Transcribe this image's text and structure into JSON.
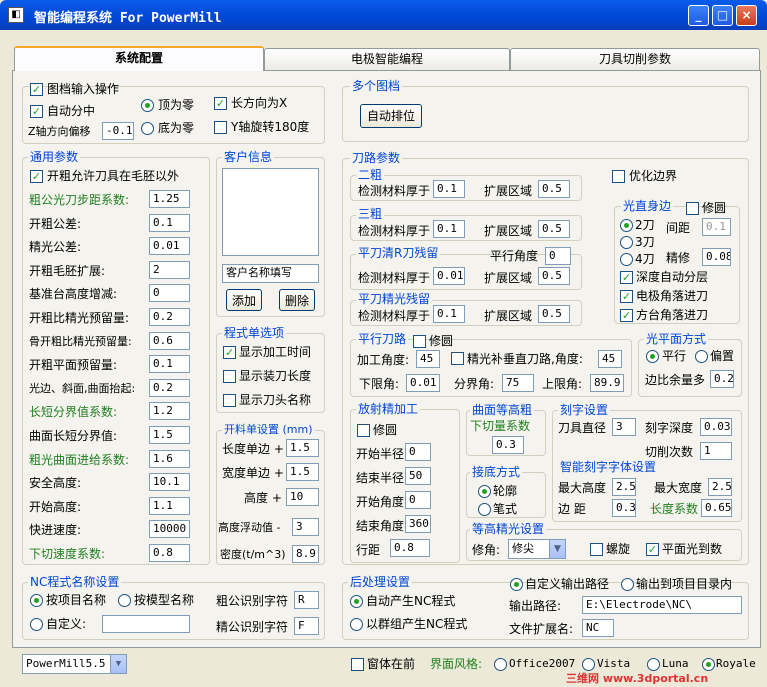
{
  "window": {
    "icon": "app-icon",
    "title": "智能编程系统 For PowerMill",
    "min": "_",
    "max": "□",
    "close": "×"
  },
  "tabs": [
    "系统配置",
    "电极智能编程",
    "刀具切削参数"
  ],
  "top": {
    "input_op": "图档输入操作",
    "auto_center": "自动分中",
    "top_zero": "顶为零",
    "bottom_zero": "底为零",
    "long_x": "长方向为X",
    "y_rot": "Y轴旋转180度",
    "z_offset_label": "Z轴方向偏移",
    "z_offset": "-0.1"
  },
  "multi": {
    "title": "多个图档",
    "auto_arrange": "自动排位"
  },
  "general": {
    "title": "通用参数",
    "allow_tool": "开粗允许刀具在毛胚以外",
    "rows": [
      {
        "label": "粗公光刀步距系数:",
        "value": "1.25",
        "green": true
      },
      {
        "label": "开粗公差:",
        "value": "0.1"
      },
      {
        "label": "精光公差:",
        "value": "0.01"
      },
      {
        "label": "开粗毛胚扩展:",
        "value": "2"
      },
      {
        "label": "基准台高度增减:",
        "value": "0"
      },
      {
        "label": "开粗比精光预留量:",
        "value": "0.2"
      },
      {
        "label": "骨开粗比精光预留量:",
        "value": "0.6"
      },
      {
        "label": "开粗平面预留量:",
        "value": "0.1"
      },
      {
        "label": "光边、斜面,曲面抬起:",
        "value": "0.2"
      },
      {
        "label": "长短分界值系数:",
        "value": "1.2",
        "green": true
      },
      {
        "label": "曲面长短分界值:",
        "value": "1.5"
      },
      {
        "label": "粗光曲面进给系数:",
        "value": "1.6",
        "green": true
      },
      {
        "label": "安全高度:",
        "value": "10.1"
      },
      {
        "label": "开始高度:",
        "value": "1.1"
      },
      {
        "label": "快进速度:",
        "value": "10000"
      },
      {
        "label": "下切速度系数:",
        "value": "0.8",
        "green": true
      }
    ]
  },
  "customer": {
    "title": "客户信息",
    "name_placeholder": "客户名称填写",
    "add": "添加",
    "delete": "删除"
  },
  "program": {
    "title": "程式单选项",
    "show_time": "显示加工时间",
    "show_length": "显示装刀长度",
    "show_toolname": "显示刀头名称"
  },
  "slot": {
    "title": "开料单设置 (mm)",
    "len_label": "长度单边 +",
    "len": "1.5",
    "wid_label": "宽度单边 +",
    "wid": "1.5",
    "hgt_label": "高度 +",
    "hgt": "10",
    "float_label": "高度浮动值 -",
    "float": "3",
    "density_label": "密度(t/m^3)",
    "density": "8.9"
  },
  "toolpath": {
    "title": "刀路参数",
    "g2": {
      "title": "二粗",
      "detect": "检测材料厚于",
      "detect_v": "0.1",
      "expand": "扩展区域",
      "expand_v": "0.5"
    },
    "g3": {
      "title": "三粗",
      "detect": "检测材料厚于",
      "detect_v": "0.1",
      "expand": "扩展区域",
      "expand_v": "0.5"
    },
    "gflat": {
      "title": "平刀清R刀残留",
      "angle": "平行角度",
      "angle_v": "0",
      "detect": "检测材料厚于",
      "detect_v": "0.01",
      "expand": "扩展区域",
      "expand_v": "0.5"
    },
    "gfin": {
      "title": "平刀精光残留",
      "detect": "检测材料厚于",
      "detect_v": "0.1",
      "expand": "扩展区域",
      "expand_v": "0.5"
    },
    "optimize": "优化边界",
    "edge": {
      "title": "光直身边",
      "trim": "修圆",
      "r2": "2刀",
      "r3": "3刀",
      "r4": "4刀",
      "gap": "间距",
      "gap_v": "0.1",
      "fine": "精修",
      "fine_v": "0.08",
      "depth_auto": "深度自动分层",
      "elec_angle": "电极角落进刀",
      "square_angle": "方台角落进刀"
    },
    "parallel": {
      "title": "平行刀路",
      "trim": "修圆",
      "angle": "加工角度:",
      "angle_v": "45",
      "fin_vert": "精光补垂直刀路,角度:",
      "fin_vert_v": "45",
      "lower": "下限角:",
      "lower_v": "0.01",
      "split": "分界角:",
      "split_v": "75",
      "upper": "上限角:",
      "upper_v": "89.9"
    },
    "plane": {
      "title": "光平面方式",
      "parallel": "平行",
      "offset": "偏置",
      "margin": "边比余量多",
      "margin_v": "0.2"
    },
    "radial": {
      "title": "放射精加工",
      "trim": "修圆",
      "start_r": "开始半径",
      "start_r_v": "0",
      "end_r": "结束半径",
      "end_r_v": "50",
      "start_a": "开始角度",
      "start_a_v": "0",
      "end_a": "结束角度",
      "end_a_v": "360",
      "row": "行距",
      "row_v": "0.8"
    },
    "surf": {
      "title": "曲面等高粗",
      "down": "下切量系数",
      "down_v": "0.3"
    },
    "bottom": {
      "title": "接底方式",
      "contour": "轮廓",
      "pen": "笔式"
    },
    "engrave": {
      "title": "刻字设置",
      "dia": "刀具直径",
      "dia_v": "3",
      "depth": "刻字深度",
      "depth_v": "0.03",
      "cuts": "切削次数",
      "cuts_v": "1"
    },
    "font": {
      "title": "智能刻字字体设置",
      "max_h": "最大高度",
      "max_h_v": "2.5",
      "max_w": "最大宽度",
      "max_w_v": "2.5",
      "edge": "边 距",
      "edge_v": "0.3",
      "len_coef": "长度系数",
      "len_coef_v": "0.65"
    },
    "zfin": {
      "title": "等高精光设置",
      "corner": "修角:",
      "corner_v": "修尖",
      "spiral": "螺旋",
      "plane_first": "平面光到数"
    }
  },
  "ncname": {
    "title": "NC程式名称设置",
    "by_project": "按项目名称",
    "by_model": "按模型名称",
    "custom": "自定义:",
    "rough_id": "粗公识别字符",
    "rough_v": "R",
    "fine_id": "精公识别字符",
    "fine_v": "F"
  },
  "post": {
    "title": "后处理设置",
    "auto_nc": "自动产生NC程式",
    "group_nc": "以群组产生NC程式",
    "custom_path": "自定义输出路径",
    "to_project": "输出到项目目录内",
    "out_label": "输出路径:",
    "out_v": "E:\\Electrode\\NC\\",
    "ext_label": "文件扩展名:",
    "ext_v": "NC"
  },
  "status": {
    "version": "PowerMill5.5",
    "on_top": "窗体在前",
    "style_label": "界面风格:",
    "styles": [
      "Office2007",
      "Vista",
      "Luna",
      "Royale"
    ],
    "watermark": "三维网 www.3dportal.cn"
  },
  "colors": {
    "accent": "#0046d5",
    "green_label": "#208020",
    "check": "#21a121"
  }
}
